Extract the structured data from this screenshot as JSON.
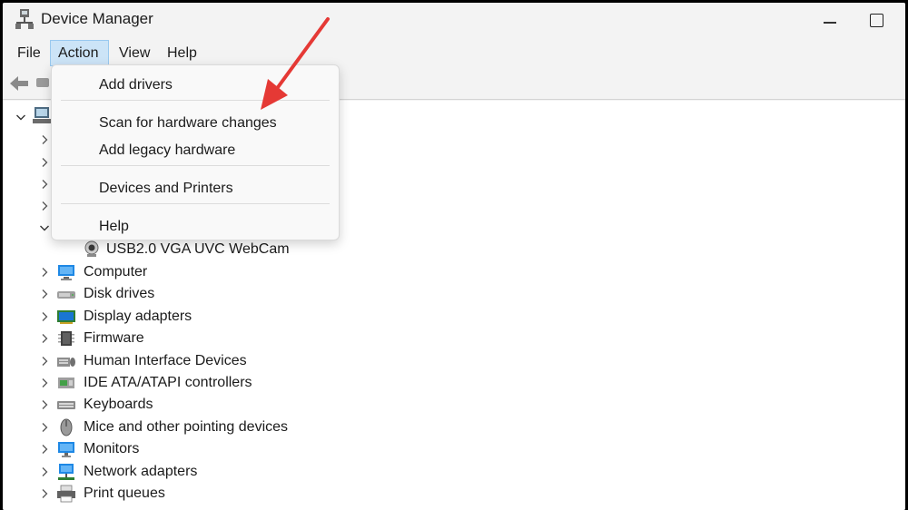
{
  "window": {
    "title": "Device Manager"
  },
  "menubar": {
    "file": "File",
    "action": "Action",
    "view": "View",
    "help": "Help"
  },
  "action_menu": {
    "items": [
      {
        "label": "Add drivers"
      },
      {
        "label": "Scan for hardware changes"
      },
      {
        "label": "Add legacy hardware"
      },
      {
        "label": "Devices and Printers"
      },
      {
        "label": "Help"
      }
    ]
  },
  "tree": {
    "webcam_child": "USB2.0 VGA UVC WebCam",
    "categories": [
      {
        "label": "Computer",
        "icon": "computer-icon"
      },
      {
        "label": "Disk drives",
        "icon": "disk-drive-icon"
      },
      {
        "label": "Display adapters",
        "icon": "display-adapter-icon"
      },
      {
        "label": "Firmware",
        "icon": "firmware-icon"
      },
      {
        "label": "Human Interface Devices",
        "icon": "hid-icon"
      },
      {
        "label": "IDE ATA/ATAPI controllers",
        "icon": "ide-controller-icon"
      },
      {
        "label": "Keyboards",
        "icon": "keyboard-icon"
      },
      {
        "label": "Mice and other pointing devices",
        "icon": "mouse-icon"
      },
      {
        "label": "Monitors",
        "icon": "monitor-icon"
      },
      {
        "label": "Network adapters",
        "icon": "network-adapter-icon"
      },
      {
        "label": "Print queues",
        "icon": "printer-icon"
      }
    ]
  },
  "colors": {
    "menu_highlight": "#cce4f7",
    "annotation_arrow": "#e53935"
  }
}
